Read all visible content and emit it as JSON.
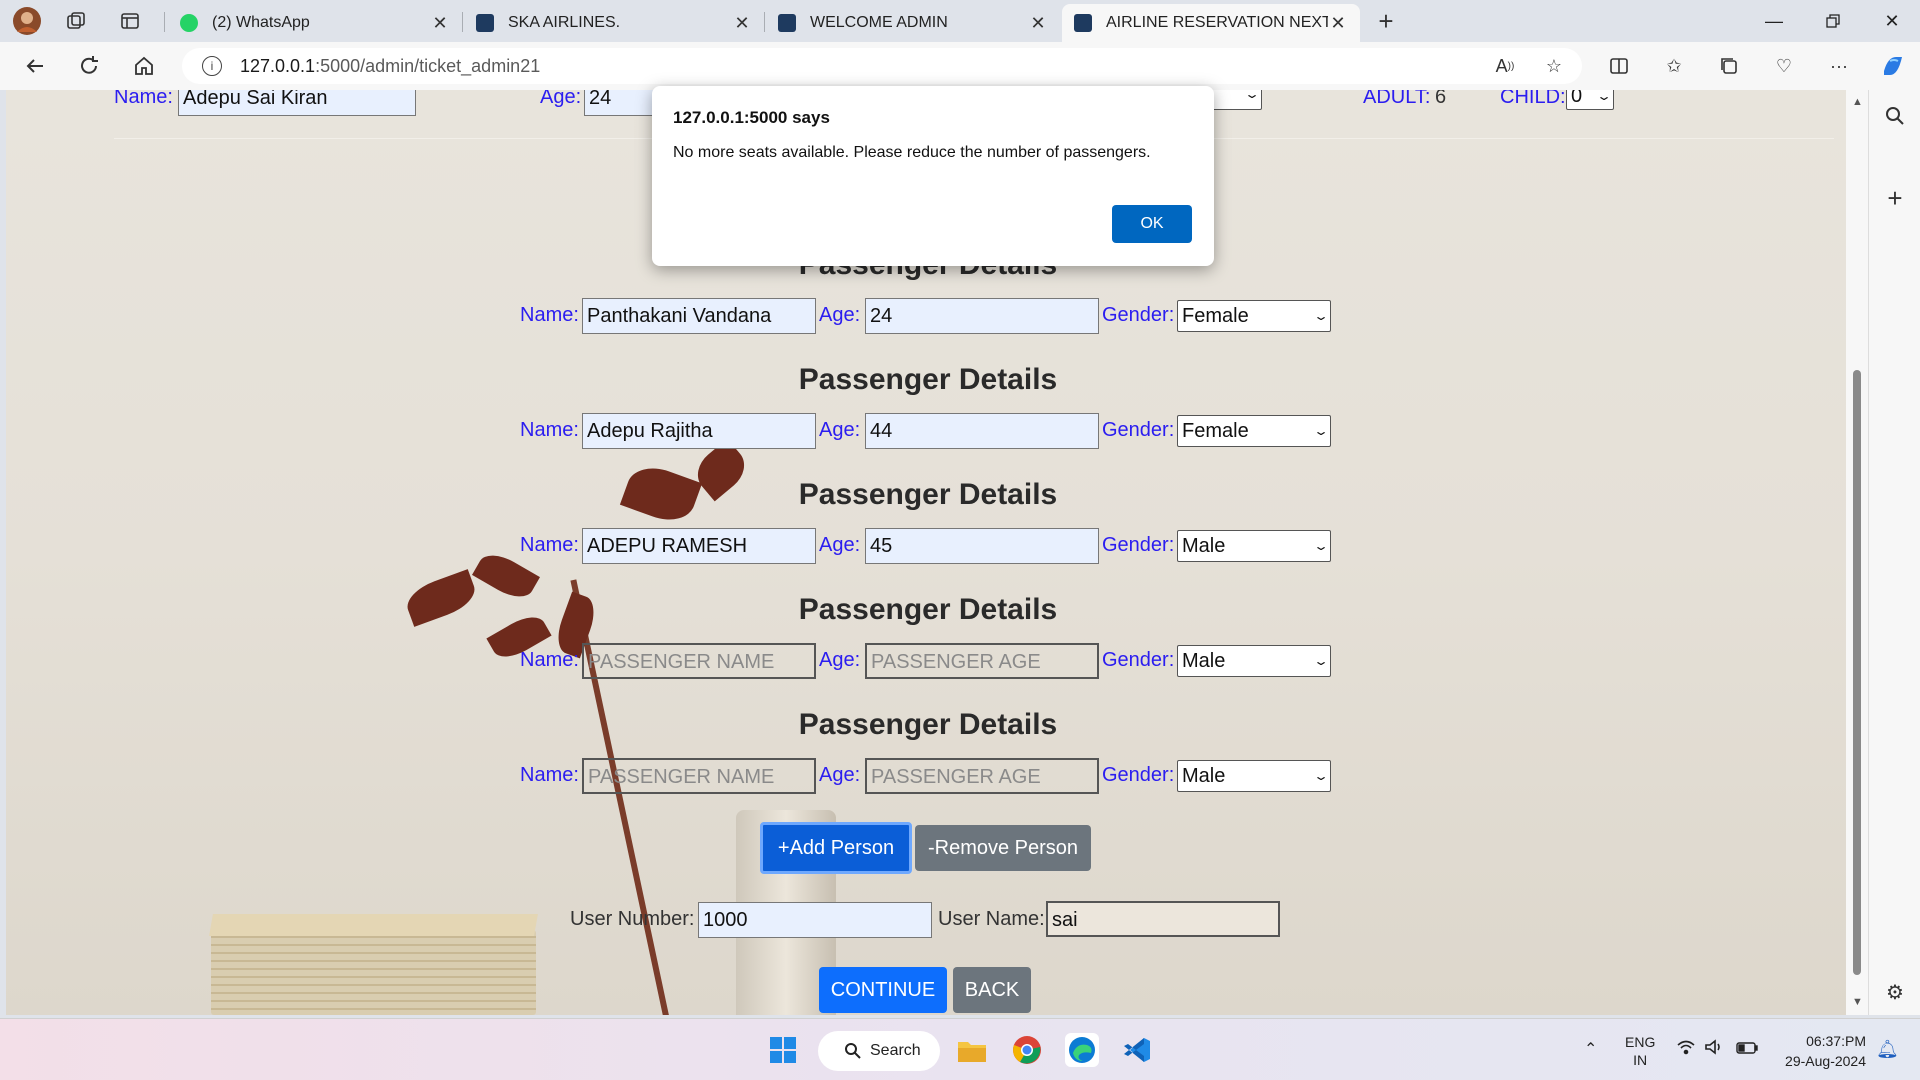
{
  "browser": {
    "tabs": [
      {
        "title": "(2) WhatsApp",
        "active": false
      },
      {
        "title": "SKA AIRLINES.",
        "active": false
      },
      {
        "title": "WELCOME ADMIN",
        "active": false
      },
      {
        "title": "AIRLINE RESERVATION NEXT STEP",
        "active": true
      }
    ],
    "url_host": "127.0.0.1",
    "url_path": ":5000/admin/ticket_admin21"
  },
  "top_row": {
    "name_label": "Name:",
    "name_value": "Adepu Sai Kiran",
    "age_label": "Age:",
    "age_value": "24",
    "adult_label": "ADULT:",
    "adult_value": "6",
    "child_label": "CHILD:",
    "child_value": "0"
  },
  "section_title": "Passenger Details",
  "labels": {
    "name": "Name:",
    "age": "Age:",
    "gender": "Gender:"
  },
  "passengers": [
    {
      "name": "Panthakani Vandana",
      "age": "24",
      "gender": "Female"
    },
    {
      "name": "Adepu Rajitha",
      "age": "44",
      "gender": "Female"
    },
    {
      "name": "ADEPU RAMESH",
      "age": "45",
      "gender": "Male"
    },
    {
      "name": "",
      "age": "",
      "gender": "Male",
      "name_placeholder": "PASSENGER NAME",
      "age_placeholder": "PASSENGER AGE"
    },
    {
      "name": "",
      "age": "",
      "gender": "Male",
      "name_placeholder": "PASSENGER NAME",
      "age_placeholder": "PASSENGER AGE"
    }
  ],
  "buttons": {
    "add_person": "+Add Person",
    "remove_person": "-Remove Person",
    "continue": "CONTINUE",
    "back": "BACK"
  },
  "user": {
    "number_label": "User Number:",
    "number_value": "1000",
    "name_label": "User Name:",
    "name_value": "sai"
  },
  "dialog": {
    "title": "127.0.0.1:5000 says",
    "message": "No more seats available. Please reduce the number of passengers.",
    "ok_label": "OK"
  },
  "taskbar": {
    "search_label": "Search",
    "lang_top": "ENG",
    "lang_bottom": "IN",
    "time": "06:37:PM",
    "date": "29-Aug-2024"
  },
  "colors": {
    "label_blue": "#2b1df0",
    "button_primary": "#0d6efd",
    "button_secondary": "#6c757d",
    "dialog_ok": "#0067c0"
  }
}
